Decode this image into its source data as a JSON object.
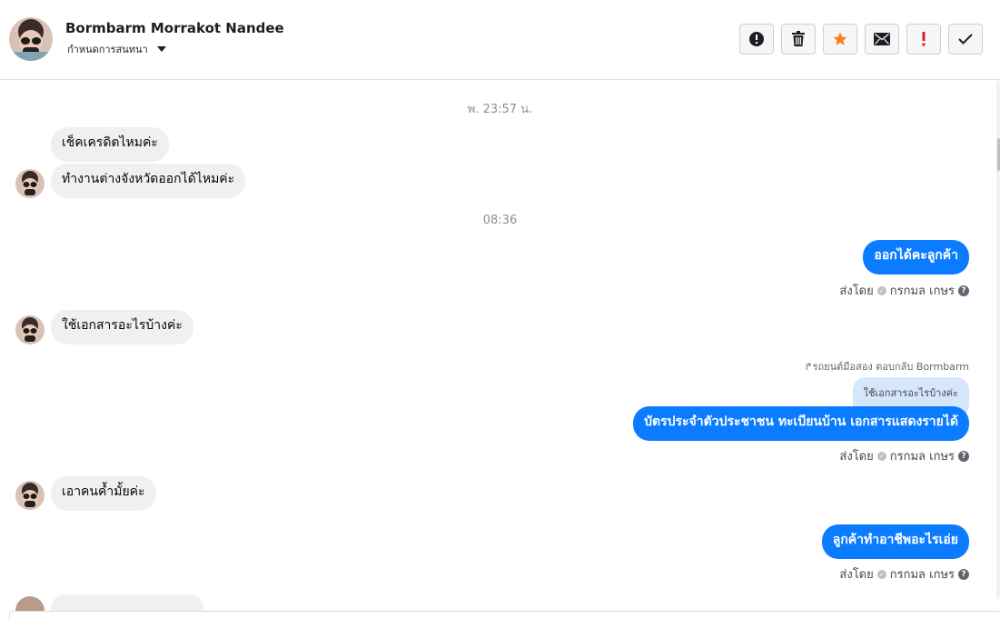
{
  "header": {
    "name": "Bormbarm Morrakot Nandee",
    "label_dropdown": "กำหนดการสนทนา",
    "actions": [
      {
        "icon": "alert-circle-icon",
        "title": "spam"
      },
      {
        "icon": "trash-icon",
        "title": "delete"
      },
      {
        "icon": "star-icon",
        "title": "star"
      },
      {
        "icon": "envelope-icon",
        "title": "mark unread"
      },
      {
        "icon": "exclamation-icon",
        "title": "important"
      },
      {
        "icon": "check-icon",
        "title": "done"
      }
    ]
  },
  "colors": {
    "outgoing_bubble": "#0b7cff",
    "incoming_bubble": "#f0f0f0",
    "quoted_bubble": "#d6e6fb",
    "star": "#f5821f",
    "exclamation": "#e02020"
  },
  "conversation": {
    "timestamps": {
      "first": "พ. 23:57 น.",
      "second": "08:36"
    },
    "messages": {
      "m1": "เช็คเครดิตไหมค่ะ",
      "m2": "ทำงานต่างจังหวัดออกได้ไหมค่ะ",
      "m3": "ออกได้คะลูกค้า",
      "m4": "ใช้เอกสารอะไรบ้างค่ะ",
      "m5_reply_meta": "รถยนต์มือสอง ตอบกลับ Bormbarm",
      "m5_quoted": "ใช้เอกสารอะไรบ้างค่ะ",
      "m5": "บัตรประจำตัวประชาชน ทะเบียนบ้าน เอกสารแสดงรายได้",
      "m6": "เอาคนค้ำมั้ยค่ะ",
      "m7": "ลูกค้าทำอาชีพอะไรเอ่ย"
    },
    "sent_by_label": "ส่งโดย",
    "sender_name": "กรกมล เกษร",
    "help_glyph": "?"
  }
}
